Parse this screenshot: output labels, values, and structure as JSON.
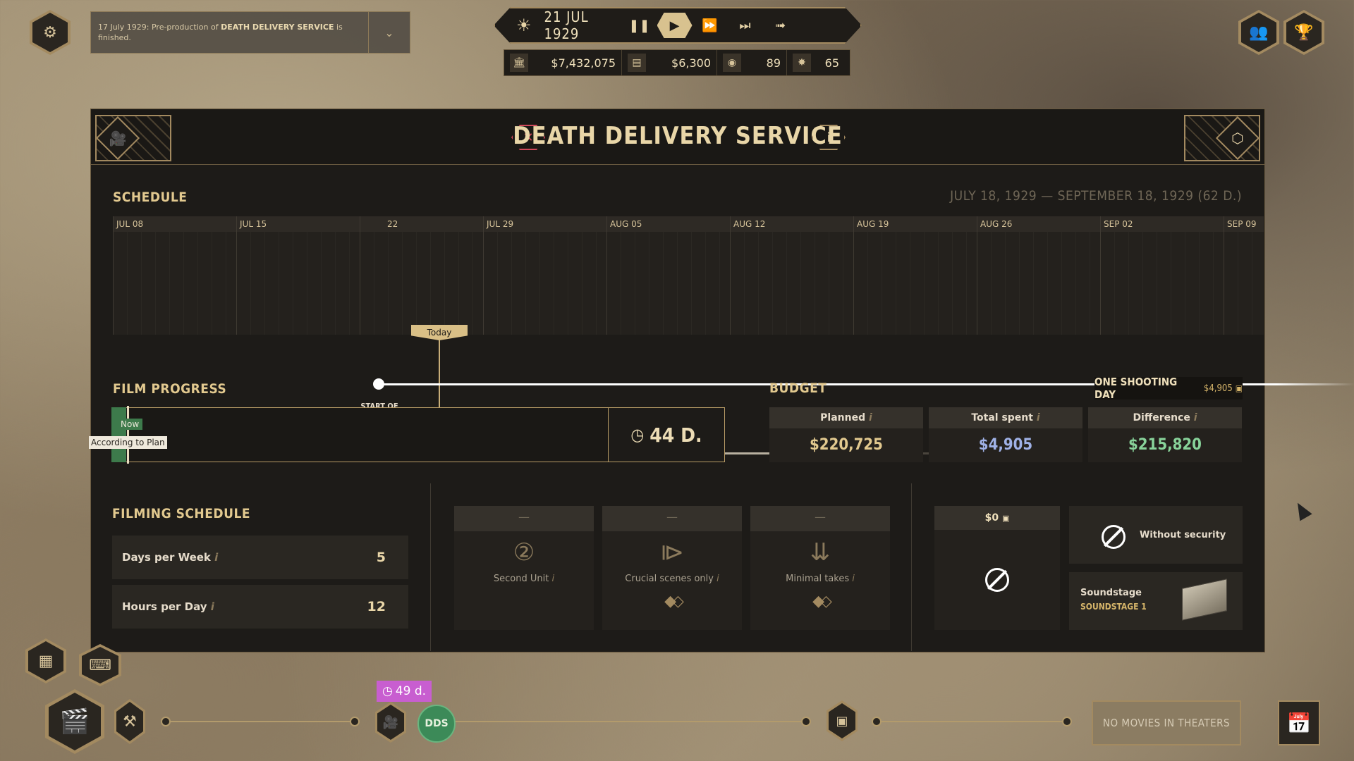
{
  "notification": {
    "prefix": "17 July 1929: Pre-production of ",
    "movie": "DEATH DELIVERY SERVICE",
    "suffix": " is finished."
  },
  "timebar": {
    "date": "21 JUL 1929",
    "icons": [
      "sun-icon",
      "pause-icon",
      "play-icon",
      "fast-forward-icon",
      "faster-icon",
      "skip-icon"
    ]
  },
  "resources": {
    "money": "$7,432,075",
    "income": "$6,300",
    "reputation": "89",
    "stars": "65"
  },
  "panel": {
    "title": "DEATH DELIVERY SERVICE",
    "schedule": {
      "heading": "SCHEDULE",
      "range": "JULY 18, 1929 — SEPTEMBER 18, 1929 (62 D.)",
      "weeks": [
        "JUL 08",
        "JUL 15",
        "22",
        "JUL 29",
        "AUG 05",
        "AUG 12",
        "AUG 19",
        "AUG 26",
        "SEP 02",
        "SEP 09"
      ],
      "today_label": "Today",
      "start_label": "START OF FILMING",
      "scroll_fraction": 0.77
    },
    "film_progress": {
      "heading": "FILM PROGRESS",
      "now_label": "Now",
      "plan_label": "According to Plan",
      "remaining": "44 D.",
      "progress_fraction": 0.03
    },
    "budget": {
      "heading": "BUDGET",
      "shooting_day_label": "ONE SHOOTING DAY",
      "shooting_day_cost": "$4,905",
      "columns": [
        {
          "label": "Planned",
          "value": "$220,725",
          "color": "#e2c98f"
        },
        {
          "label": "Total spent",
          "value": "$4,905",
          "color": "#9fb1e6"
        },
        {
          "label": "Difference",
          "value": "$215,820",
          "color": "#88d39a"
        }
      ]
    },
    "filming_schedule": {
      "heading": "FILMING SCHEDULE",
      "days_label": "Days per Week",
      "days_value": "5",
      "hours_label": "Hours per Day",
      "hours_value": "12"
    },
    "options": [
      {
        "header": "—",
        "label": "Second Unit",
        "icon": "second-unit-icon"
      },
      {
        "header": "—",
        "label": "Crucial scenes only",
        "icon": "crucial-scenes-icon"
      },
      {
        "header": "—",
        "label": "Minimal takes",
        "icon": "minimal-takes-icon"
      }
    ],
    "security": {
      "cost": "$0",
      "label": "Without security"
    },
    "soundstage": {
      "label": "Soundstage",
      "value": "SOUNDSTAGE 1"
    }
  },
  "bottom": {
    "duration": "49 d.",
    "movie_badge": "DDS",
    "theaters": "NO MOVIES IN THEATERS"
  }
}
